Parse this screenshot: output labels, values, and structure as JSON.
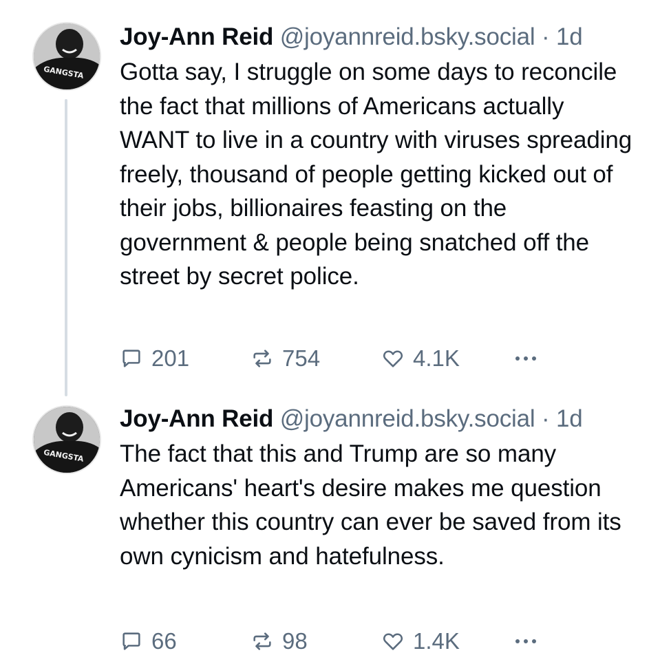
{
  "posts": [
    {
      "author": {
        "display_name": "Joy-Ann Reid",
        "handle": "@joyannreid.bsky.social",
        "avatar_shirt_text": "GANGSTA"
      },
      "separator": "·",
      "time": "1d",
      "text": "Gotta say, I struggle on some days to reconcile the fact that millions of Americans actually WANT to live in a country with viruses spreading freely, thousand of people getting kicked out of their jobs, billionaires feasting on the government & people being snatched off the street by secret police.",
      "counts": {
        "replies": "201",
        "reposts": "754",
        "likes": "4.1K"
      },
      "icons": {
        "reply": "reply-icon",
        "repost": "repost-icon",
        "like": "heart-icon",
        "more": "more-options-icon"
      }
    },
    {
      "author": {
        "display_name": "Joy-Ann Reid",
        "handle": "@joyannreid.bsky.social",
        "avatar_shirt_text": "GANGSTA"
      },
      "separator": "·",
      "time": "1d",
      "text": "The fact that this and Trump are so many Americans' heart's desire makes me question whether this country can ever be saved from its own cynicism and hatefulness.",
      "counts": {
        "replies": "66",
        "reposts": "98",
        "likes": "1.4K"
      },
      "icons": {
        "reply": "reply-icon",
        "repost": "repost-icon",
        "like": "heart-icon",
        "more": "more-options-icon"
      }
    }
  ],
  "colors": {
    "text": "#0b0f14",
    "muted": "#5b6c7e",
    "thread_line": "#d6dde3",
    "background": "#ffffff"
  }
}
